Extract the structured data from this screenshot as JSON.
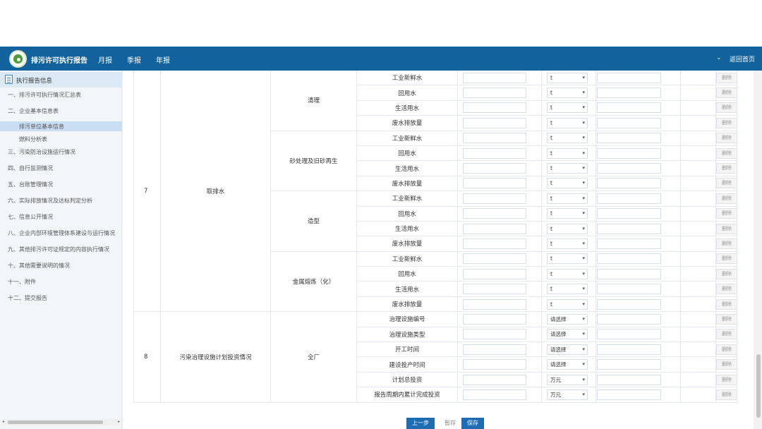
{
  "header": {
    "app_title": "排污许可执行报告",
    "nav": [
      "月报",
      "季报",
      "年报"
    ],
    "home_label": "返回首页",
    "caret": "⌄"
  },
  "sidebar": {
    "section_title": "执行报告信息",
    "items": [
      "一、排污许可执行情况汇总表",
      "二、企业基本信息表",
      "排污单位基本信息",
      "燃料分析表",
      "三、污染防治设施运行情况",
      "四、自行监测情况",
      "五、台账管理情况",
      "六、实际排放情况及达标判定分析",
      "七、信息公开情况",
      "八、企业内部环境管理体系建设与运行情况",
      "九、其他排污许可证规定的内容执行情况",
      "十、其他需要说明的情况",
      "十一、附件",
      "十二、提交报告"
    ],
    "active_item": "排污单位基本信息"
  },
  "table": {
    "groups": [
      {
        "no": "7",
        "item": "取排水",
        "processes": [
          {
            "name": "清理",
            "rows": [
              {
                "label": "工业新鲜水",
                "unit": "t"
              },
              {
                "label": "回用水",
                "unit": "t"
              },
              {
                "label": "生活用水",
                "unit": "t"
              },
              {
                "label": "废水排放量",
                "unit": "t"
              }
            ]
          },
          {
            "name": "砂处理及旧砂再生",
            "rows": [
              {
                "label": "工业新鲜水",
                "unit": "t"
              },
              {
                "label": "回用水",
                "unit": "t"
              },
              {
                "label": "生活用水",
                "unit": "t"
              },
              {
                "label": "废水排放量",
                "unit": "t"
              }
            ]
          },
          {
            "name": "造型",
            "rows": [
              {
                "label": "工业新鲜水",
                "unit": "t"
              },
              {
                "label": "回用水",
                "unit": "t"
              },
              {
                "label": "生活用水",
                "unit": "t"
              },
              {
                "label": "废水排放量",
                "unit": "t"
              }
            ]
          },
          {
            "name": "金属熔炼（化）",
            "rows": [
              {
                "label": "工业新鲜水",
                "unit": "t"
              },
              {
                "label": "回用水",
                "unit": "t"
              },
              {
                "label": "生活用水",
                "unit": "t"
              },
              {
                "label": "废水排放量",
                "unit": "t"
              }
            ]
          }
        ]
      },
      {
        "no": "8",
        "item": "污染治理设施计划投资情况",
        "processes": [
          {
            "name": "全厂",
            "rows": [
              {
                "label": "治理设施编号",
                "unit": "请选择"
              },
              {
                "label": "治理设施类型",
                "unit": "请选择"
              },
              {
                "label": "开工时间",
                "unit": "请选择"
              },
              {
                "label": "建设投产时间",
                "unit": "请选择"
              },
              {
                "label": "计划总投资",
                "unit": "万元"
              },
              {
                "label": "报告周期内累计完成投资",
                "unit": "万元"
              }
            ]
          }
        ]
      }
    ],
    "delete_label": "删除",
    "select_arrow": "▾"
  },
  "footer": {
    "prev_label": "上一步",
    "draft_label": "暂存",
    "save_label": "保存"
  },
  "colors": {
    "topbar": "#12639d",
    "primary_button": "#1e6db2",
    "sidebar_active": "#c9def2"
  }
}
